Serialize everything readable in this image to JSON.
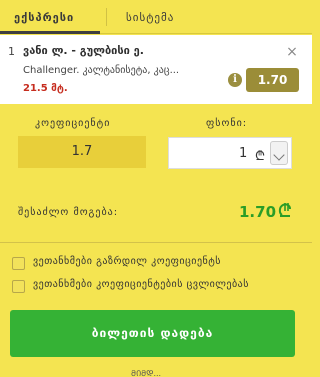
{
  "tabs": {
    "express_label": "ექსპრესი",
    "system_label": "სისტემა"
  },
  "bet": {
    "index": "1",
    "title": "ვანი ლ. - გულბისი ე.",
    "market": "Challenger. კალტანისეტა, კაც...",
    "time": "21.5 მტ.",
    "odds": "1.70"
  },
  "coefficient": {
    "label": "კოეფიციენტი",
    "value": "1.7"
  },
  "stake": {
    "label": "ფსონი:",
    "value": "1",
    "currency": "₾"
  },
  "potential_win": {
    "label": "შესაძლო მოგება:",
    "amount": "1.70"
  },
  "options": [
    {
      "label": "ვეთანხმები გაზრდილ კოეფიციენტს"
    },
    {
      "label": "ვეთანხმები კოეფიციენტების ცვლილებას"
    }
  ],
  "actions": {
    "place_bet_label": "ბილეთის დადება"
  },
  "footer": {
    "partial_text": "ᲛᲘᲛᲓ..."
  }
}
